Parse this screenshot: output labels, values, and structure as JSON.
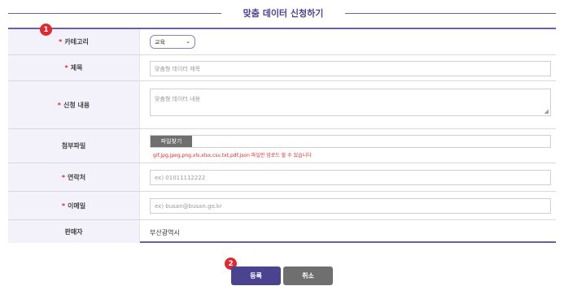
{
  "page": {
    "title": "맞춤 데이터 신청하기"
  },
  "badges": {
    "first": "1",
    "second": "2"
  },
  "required_mark": "*",
  "form": {
    "category": {
      "label": "카테고리",
      "selected": "교육"
    },
    "subject": {
      "label": "제목",
      "placeholder": "맞춤형 데이터 제목"
    },
    "content": {
      "label": "신청 내용",
      "placeholder": "맞춤형 데이터 내용"
    },
    "attachment": {
      "label": "첨부파일",
      "button": "파일찾기",
      "note": "gif,jpg,jpeg,png,xls,xlsx,csv,txt,pdf,json 파일만 업로드 할 수 있습니다"
    },
    "contact": {
      "label": "연락처",
      "placeholder": "ex) 01011112222"
    },
    "email": {
      "label": "이메일",
      "placeholder": "ex) busan@busan.go.kr"
    },
    "seller": {
      "label": "판매자",
      "value": "부산광역시"
    }
  },
  "actions": {
    "submit": "등록",
    "cancel": "취소"
  },
  "colors": {
    "accent": "#4a4390",
    "required": "#e0282e",
    "label_bg": "#f3f2fa",
    "secondary_button": "#6f6f6f"
  }
}
